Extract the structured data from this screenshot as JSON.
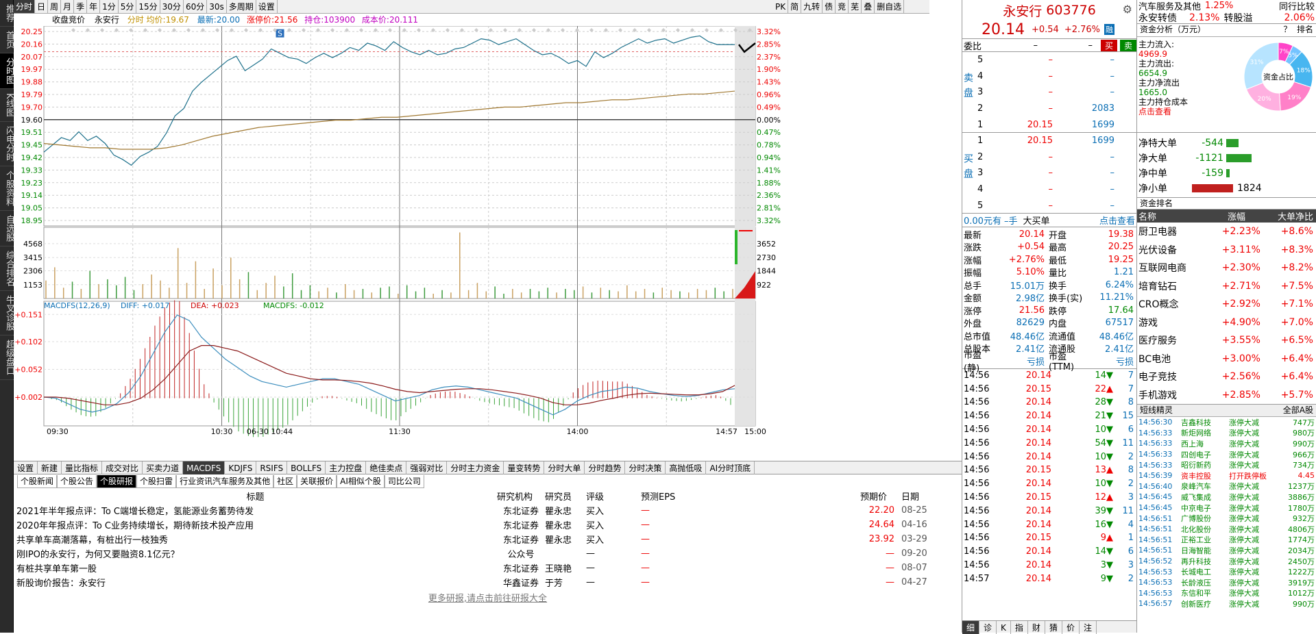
{
  "left_nav": [
    "推荐",
    "首页",
    "分时图",
    "K线图",
    "闪电分时",
    "个股资料",
    "自选股",
    "综合排名",
    "牛叉诊股",
    "超级盘口"
  ],
  "left_nav_active": 2,
  "top_periods": [
    "分时",
    "日",
    "周",
    "月",
    "季",
    "年",
    "1分",
    "5分",
    "15分",
    "30分",
    "60分",
    "30s",
    "多周期",
    "设置"
  ],
  "top_active": 0,
  "top_right_tools": [
    "PK",
    "简",
    "九转",
    "债",
    "竞",
    "芜",
    "叠",
    "删自选"
  ],
  "info": {
    "label1": "收盘竞价",
    "name": "永安行",
    "fenshi": "分时",
    "avg_label": "均价:",
    "avg": "19.67",
    "latest_label": "最新:",
    "latest": "20.00",
    "limit_label": "涨停价:21.56",
    "hold_label": "持仓:",
    "hold": "103900",
    "cost_label": "成本价:",
    "cost": "20.111"
  },
  "chart_data": {
    "type": "line",
    "time_labels": [
      "09:30",
      "10:30",
      "06-30 10:44",
      "11:30",
      "14:00",
      "14:57",
      "15:00"
    ],
    "price_axis": [
      "20.25",
      "20.16",
      "20.07",
      "19.97",
      "19.88",
      "19.79",
      "19.70",
      "19.60",
      "19.51",
      "19.45",
      "19.42",
      "19.33",
      "19.23",
      "19.14",
      "19.05",
      "18.95"
    ],
    "pct_axis": [
      "3.32%",
      "2.85%",
      "2.37%",
      "1.90%",
      "1.43%",
      "0.96%",
      "0.49%",
      "0.00%",
      "0.47%",
      "0.78%",
      "0.94%",
      "1.41%",
      "1.88%",
      "2.36%",
      "2.81%",
      "3.32%"
    ],
    "prev_close": 19.6,
    "price_ylim": [
      18.95,
      20.25
    ],
    "price_series": [
      19.42,
      19.47,
      19.52,
      19.5,
      19.56,
      19.5,
      19.53,
      19.48,
      19.4,
      19.37,
      19.33,
      19.39,
      19.42,
      19.46,
      19.55,
      19.67,
      19.72,
      19.84,
      19.9,
      19.95,
      20.0,
      20.05,
      20.08,
      19.98,
      20.02,
      20.06,
      20.13,
      20.1,
      20.07,
      20.06,
      20.03,
      20.07,
      20.1,
      20.07,
      20.1,
      20.14,
      20.12,
      20.17,
      20.15,
      20.12,
      20.18,
      20.14,
      20.11,
      20.09,
      20.12,
      20.09,
      20.1,
      20.13,
      20.14,
      20.17,
      20.2,
      20.19,
      20.16,
      20.18,
      20.2,
      20.16,
      20.12,
      20.09,
      20.1,
      20.07,
      20.03,
      20.05,
      20.01,
      20.11,
      20.07,
      20.1,
      20.14,
      20.17,
      20.2,
      20.17,
      20.19,
      20.2,
      20.17,
      20.19,
      20.21,
      20.22,
      20.18,
      20.16,
      20.16,
      20.16
    ],
    "avg_series": [
      19.48,
      19.47,
      19.46,
      19.45,
      19.45,
      19.44,
      19.44,
      19.44,
      19.45,
      19.47,
      19.5,
      19.53,
      19.55,
      19.57,
      19.59,
      19.6,
      19.61,
      19.62,
      19.63,
      19.64,
      19.64,
      19.65,
      19.66,
      19.66,
      19.67,
      19.68,
      19.69,
      19.7,
      19.71,
      19.72,
      19.73,
      19.73,
      19.74,
      19.75,
      19.76,
      19.76,
      19.77,
      19.78,
      19.78,
      19.79,
      19.8,
      19.81,
      19.82,
      19.82,
      19.83,
      19.84
    ],
    "vol_axis": [
      "4568",
      "3415",
      "2306",
      "1153"
    ],
    "vol_axis_right": [
      "3652",
      "2730",
      "1844",
      "922"
    ],
    "vol_ylim": [
      0,
      5700
    ],
    "volumes": [
      1500,
      2600,
      900,
      1400,
      800,
      2300,
      1200,
      1600,
      1100,
      1800,
      700,
      1200,
      2000,
      1500,
      900,
      4200,
      1300,
      3100,
      800,
      2500,
      1100,
      3400,
      1600,
      2200,
      700,
      1300,
      1900,
      1000,
      2100,
      700,
      1100,
      600,
      900,
      500,
      1200,
      700,
      800,
      500,
      900,
      1000,
      400,
      1100,
      600,
      900,
      400,
      700,
      500,
      5500,
      700,
      1300,
      600,
      1000,
      400,
      800,
      500,
      800,
      600,
      900,
      500,
      800,
      700,
      1000,
      500,
      900,
      700,
      600,
      1100,
      600,
      800,
      500,
      900,
      700,
      600,
      500,
      800,
      700,
      900,
      600,
      800
    ],
    "macd_title": "MACDFS(12,26,9)",
    "diff_label": "DIFF: +0.017",
    "dea_label": "DEA: +0.023",
    "macdfs_label": "MACDFS: -0.012",
    "macd_axis": [
      "+0.151",
      "+0.102",
      "+0.052",
      "+0.002"
    ],
    "macd_ylim": [
      -0.04,
      0.16
    ],
    "diff_series": [
      0.002,
      0.0,
      -0.01,
      -0.02,
      -0.025,
      -0.02,
      -0.01,
      0.01,
      0.04,
      0.08,
      0.12,
      0.15,
      0.14,
      0.11,
      0.09,
      0.07,
      0.055,
      0.04,
      0.03,
      0.025,
      0.02,
      0.025,
      0.03,
      0.035,
      0.035,
      0.03,
      0.025,
      0.015,
      0.005,
      -0.005,
      0.0,
      0.005,
      0.015,
      0.02,
      0.022,
      0.02,
      0.015,
      0.01,
      0.005,
      0.0,
      -0.01,
      -0.02,
      -0.03,
      -0.02,
      -0.005,
      0.005,
      0.012,
      0.015,
      0.02,
      0.018,
      0.012,
      0.008,
      0.005,
      0.003,
      0.005,
      0.01,
      0.015,
      0.017
    ],
    "dea_series": [
      0.002,
      0.002,
      0.0,
      -0.004,
      -0.008,
      -0.012,
      -0.012,
      -0.008,
      0.0,
      0.015,
      0.035,
      0.06,
      0.085,
      0.095,
      0.095,
      0.09,
      0.085,
      0.075,
      0.065,
      0.055,
      0.045,
      0.04,
      0.035,
      0.033,
      0.033,
      0.032,
      0.03,
      0.027,
      0.022,
      0.016,
      0.012,
      0.01,
      0.012,
      0.014,
      0.016,
      0.017,
      0.017,
      0.015,
      0.012,
      0.009,
      0.005,
      0.0,
      -0.008,
      -0.012,
      -0.012,
      -0.009,
      -0.004,
      0.0,
      0.005,
      0.008,
      0.009,
      0.008,
      0.007,
      0.006,
      0.006,
      0.008,
      0.012,
      0.023
    ]
  },
  "order_book": {
    "title": "委比",
    "wb1": "–",
    "wb2": "–",
    "buy_btn": "买",
    "sell_btn": "卖",
    "sell_label": "卖盘",
    "buy_label": "买盘",
    "sells": [
      [
        "5",
        "–",
        "–"
      ],
      [
        "4",
        "–",
        "–"
      ],
      [
        "3",
        "–",
        "–"
      ],
      [
        "2",
        "–",
        "2083"
      ],
      [
        "1",
        "20.15",
        "1699"
      ]
    ],
    "buys": [
      [
        "1",
        "20.15",
        "1699"
      ],
      [
        "2",
        "–",
        "–"
      ],
      [
        "3",
        "–",
        "–"
      ],
      [
        "4",
        "–",
        "–"
      ],
      [
        "5",
        "–",
        "–"
      ]
    ],
    "footer_left": "0.00元有",
    "footer_mid": "–手",
    "footer_type": "大买单",
    "footer_right": "点击查看"
  },
  "header": {
    "name": "永安行",
    "code": "603776",
    "price": "20.14",
    "chg": "+0.54",
    "pct": "+2.76%",
    "tag": "融"
  },
  "quote": [
    [
      "最新",
      "20.14",
      "开盘",
      "19.38"
    ],
    [
      "涨跌",
      "+0.54",
      "最高",
      "20.25"
    ],
    [
      "涨幅",
      "+2.76%",
      "最低",
      "19.25"
    ],
    [
      "振幅",
      "5.10%",
      "量比",
      "1.21"
    ],
    [
      "总手",
      "15.01万",
      "换手",
      "6.24%"
    ],
    [
      "金额",
      "2.98亿",
      "换手(实)",
      "11.21%"
    ],
    [
      "涨停",
      "21.56",
      "跌停",
      "17.64"
    ],
    [
      "外盘",
      "82629",
      "内盘",
      "67517"
    ],
    [
      "总市值",
      "48.46亿",
      "流通值",
      "48.46亿"
    ],
    [
      "总股本",
      "2.41亿",
      "流通股",
      "2.41亿"
    ],
    [
      "市盈(静)",
      "亏损",
      "市盈(TTM)",
      "亏损"
    ]
  ],
  "ticks": [
    [
      "14:56",
      "20.14",
      "14",
      "7"
    ],
    [
      "14:56",
      "20.15",
      "22",
      "7"
    ],
    [
      "14:56",
      "20.14",
      "28",
      "8"
    ],
    [
      "14:56",
      "20.14",
      "21",
      "15"
    ],
    [
      "14:56",
      "20.14",
      "10",
      "6"
    ],
    [
      "14:56",
      "20.14",
      "54",
      "11"
    ],
    [
      "14:56",
      "20.14",
      "10",
      "2"
    ],
    [
      "14:56",
      "20.15",
      "13",
      "8"
    ],
    [
      "14:56",
      "20.14",
      "10",
      "2"
    ],
    [
      "14:56",
      "20.15",
      "12",
      "3"
    ],
    [
      "14:56",
      "20.14",
      "39",
      "11"
    ],
    [
      "14:56",
      "20.14",
      "16",
      "4"
    ],
    [
      "14:56",
      "20.15",
      "9",
      "1"
    ],
    [
      "14:56",
      "20.14",
      "14",
      "6"
    ],
    [
      "14:56",
      "20.14",
      "3",
      "3"
    ],
    [
      "14:57",
      "20.14",
      "9",
      "2"
    ]
  ],
  "tick_dirs": [
    "down",
    "up",
    "down",
    "down",
    "down",
    "down",
    "down",
    "up",
    "down",
    "up",
    "down",
    "down",
    "up",
    "down",
    "down",
    "down"
  ],
  "rp_tabs": [
    "细",
    "诊",
    "K",
    "指",
    "财",
    "猜",
    "价",
    "注"
  ],
  "sector": {
    "row1_name": "汽车服务及其他",
    "row1_pct": "1.25%",
    "row1_right": "同行比较",
    "row2_name": "永安转债",
    "row2_pct": "2.13%",
    "row2_mid": "转股溢",
    "row2_val": "2.06%"
  },
  "fund": {
    "title": "资金分析（万元）",
    "help": "？",
    "rank": "排名",
    "in_label": "主力流入:",
    "in_val": "4969.9",
    "out_label": "主力流出:",
    "out_val": "6654.9",
    "net_label": "主力净流出",
    "net_val": "1665.0",
    "cost_label": "主力持仓成本",
    "cost_link": "点击查看",
    "donut_label": "资金占比",
    "donut_vals": [
      "7%",
      "5%",
      "18%",
      "19%",
      "20%",
      "31%"
    ]
  },
  "netflows": [
    [
      "净特大单",
      "-544"
    ],
    [
      "净大单",
      "-1121"
    ],
    [
      "净中单",
      "-159"
    ],
    [
      "净小单",
      "1824"
    ]
  ],
  "fund_rank": {
    "title": "资金排名",
    "h1": "名称",
    "h2": "涨幅",
    "h3": "大单净比",
    "rows": [
      [
        "厨卫电器",
        "+2.23%",
        "+8.6%"
      ],
      [
        "光伏设备",
        "+3.11%",
        "+8.3%"
      ],
      [
        "互联网电商",
        "+2.30%",
        "+8.2%"
      ],
      [
        "培育钻石",
        "+2.71%",
        "+7.5%"
      ],
      [
        "CRO概念",
        "+2.92%",
        "+7.1%"
      ],
      [
        "游戏",
        "+4.90%",
        "+7.0%"
      ],
      [
        "医疗服务",
        "+3.55%",
        "+6.5%"
      ],
      [
        "BC电池",
        "+3.00%",
        "+6.4%"
      ],
      [
        "电子竞技",
        "+2.56%",
        "+6.4%"
      ],
      [
        "手机游戏",
        "+2.85%",
        "+5.7%"
      ]
    ]
  },
  "short": {
    "title": "短线精灵",
    "filter": "全部A股",
    "rows": [
      [
        "14:56:30",
        "吉鑫科技",
        "涨停大减",
        "747万"
      ],
      [
        "14:56:33",
        "新炬网络",
        "涨停大减",
        "980万"
      ],
      [
        "14:56:33",
        "西上海",
        "涨停大减",
        "990万"
      ],
      [
        "14:56:33",
        "四创电子",
        "涨停大减",
        "966万"
      ],
      [
        "14:56:33",
        "昭衍新药",
        "涨停大减",
        "734万"
      ],
      [
        "14:56:39",
        "资丰控股",
        "打开跌停板",
        "4.45"
      ],
      [
        "14:56:40",
        "泉峰汽车",
        "涨停大减",
        "1237万"
      ],
      [
        "14:56:45",
        "威飞集成",
        "涨停大减",
        "3886万"
      ],
      [
        "14:56:45",
        "中京电子",
        "涨停大减",
        "1780万"
      ],
      [
        "14:56:51",
        "广博股份",
        "涨停大减",
        "932万"
      ],
      [
        "14:56:51",
        "北化股份",
        "涨停大减",
        "4806万"
      ],
      [
        "14:56:51",
        "正裕工业",
        "涨停大减",
        "1774万"
      ],
      [
        "14:56:51",
        "日海智能",
        "涨停大减",
        "2034万"
      ],
      [
        "14:56:52",
        "再升科技",
        "涨停大减",
        "2450万"
      ],
      [
        "14:56:53",
        "长城电工",
        "涨停大减",
        "1222万"
      ],
      [
        "14:56:53",
        "长龄液压",
        "涨停大减",
        "3919万"
      ],
      [
        "14:56:53",
        "东信和平",
        "涨停大减",
        "1012万"
      ],
      [
        "14:56:57",
        "创新医疗",
        "涨停大减",
        "990万"
      ]
    ]
  },
  "indicator_tabs": [
    "设置",
    "新建",
    "量比指标",
    "成交对比",
    "买卖力道",
    "MACDFS",
    "KDJFS",
    "RSIFS",
    "BOLLFS",
    "主力控盘",
    "绝佳卖点",
    "强弱对比",
    "分时主力资金",
    "量变转势",
    "分时大单",
    "分时趋势",
    "分时决策",
    "高抛低吸",
    "AI分时顶底"
  ],
  "indicator_active": 5,
  "research_tabs": [
    "个股新闻",
    "个股公告",
    "个股研报",
    "个股扫雷",
    "行业资讯汽车服务及其他",
    "社区",
    "关联报价",
    "AI相似个股",
    "司比公司"
  ],
  "research_active": 2,
  "research": {
    "h_title": "标题",
    "h_org": "研究机构",
    "h_analyst": "研究员",
    "h_rating": "评级",
    "h_eps": "预测EPS",
    "h_target": "预期价",
    "h_date": "日期",
    "rows": [
      [
        "2021年半年报点评：To C端增长稳定，氢能源业务蓄势待发",
        "东北证券",
        "瞿永忠",
        "买入",
        "—",
        "22.20",
        "08-25"
      ],
      [
        "2020年年报点评：To C业务持续增长，期待新技术投产应用",
        "东北证券",
        "瞿永忠",
        "买入",
        "—",
        "24.64",
        "04-16"
      ],
      [
        "共享单车高潮落幕，有桩出行一枝独秀",
        "东北证券",
        "瞿永忠",
        "买入",
        "—",
        "23.92",
        "03-29"
      ],
      [
        "刚IPO的永安行，为何又要融资8.1亿元？",
        "公众号",
        "",
        "—",
        "—",
        "—",
        "09-20"
      ],
      [
        "有桩共享单车第一股",
        "东北证券",
        "王晓艳",
        "—",
        "—",
        "—",
        "08-07"
      ],
      [
        "新股询价报告：永安行",
        "华鑫证券",
        "于芳",
        "—",
        "—",
        "—",
        "04-27"
      ]
    ],
    "more": "更多研报,请点击前往研报大全"
  },
  "colors": {
    "up": "#e00000",
    "down": "#008000",
    "price_line": "#1b6f8a",
    "avg_line": "#a07830",
    "grid": "#bbbbbb"
  }
}
